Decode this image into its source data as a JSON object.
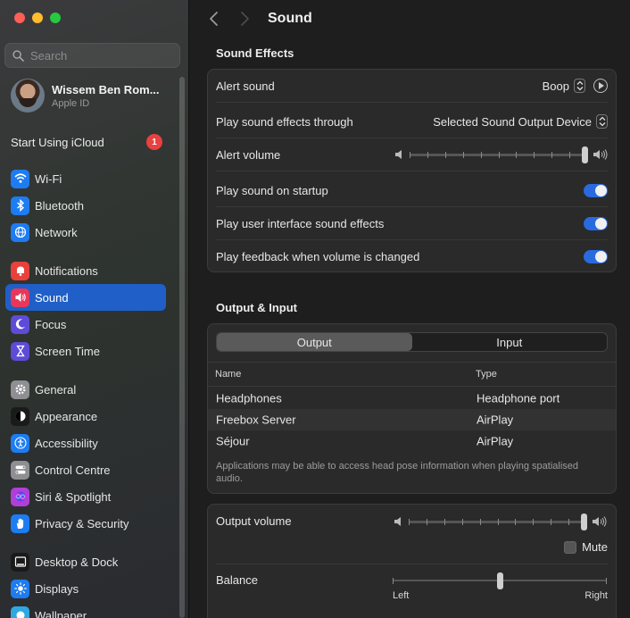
{
  "sidebar": {
    "search_placeholder": "Search",
    "profile": {
      "name": "Wissem Ben Rom...",
      "subtitle": "Apple ID"
    },
    "icloud": {
      "label": "Start Using iCloud",
      "badge": "1"
    },
    "items": [
      {
        "label": "Wi-Fi",
        "icon": "wifi-icon",
        "color": "#1d7cf2"
      },
      {
        "label": "Bluetooth",
        "icon": "bluetooth-icon",
        "color": "#1d7cf2"
      },
      {
        "label": "Network",
        "icon": "globe-icon",
        "color": "#1d7cf2"
      },
      {
        "label": "Notifications",
        "icon": "bell-icon",
        "color": "#e8413b"
      },
      {
        "label": "Sound",
        "icon": "speaker-icon",
        "color": "#e8375a"
      },
      {
        "label": "Focus",
        "icon": "moon-icon",
        "color": "#5e4bd8"
      },
      {
        "label": "Screen Time",
        "icon": "hourglass-icon",
        "color": "#5e4bd8"
      },
      {
        "label": "General",
        "icon": "gear-icon",
        "color": "#8e8e93"
      },
      {
        "label": "Appearance",
        "icon": "appearance-icon",
        "color": "#1a1a1a"
      },
      {
        "label": "Accessibility",
        "icon": "accessibility-icon",
        "color": "#1d7cf2"
      },
      {
        "label": "Control Centre",
        "icon": "control-centre-icon",
        "color": "#8e8e93"
      },
      {
        "label": "Siri & Spotlight",
        "icon": "siri-icon",
        "color": "#b03fd8"
      },
      {
        "label": "Privacy & Security",
        "icon": "hand-icon",
        "color": "#1d7cf2"
      },
      {
        "label": "Desktop & Dock",
        "icon": "dock-icon",
        "color": "#1a1a1a"
      },
      {
        "label": "Displays",
        "icon": "sun-icon",
        "color": "#1d7cf2"
      },
      {
        "label": "Wallpaper",
        "icon": "wallpaper-icon",
        "color": "#2fa8e0"
      }
    ],
    "active_item": "Sound"
  },
  "header": {
    "title": "Sound"
  },
  "sound_effects": {
    "title": "Sound Effects",
    "alert_sound": {
      "label": "Alert sound",
      "value": "Boop"
    },
    "play_through": {
      "label": "Play sound effects through",
      "value": "Selected Sound Output Device"
    },
    "alert_volume": {
      "label": "Alert volume",
      "level": 1.0
    },
    "startup": {
      "label": "Play sound on startup",
      "on": true
    },
    "ui_sounds": {
      "label": "Play user interface sound effects",
      "on": true
    },
    "feedback": {
      "label": "Play feedback when volume is changed",
      "on": true
    }
  },
  "output_input": {
    "title": "Output & Input",
    "tabs": [
      "Output",
      "Input"
    ],
    "selected_tab": "Output",
    "columns": [
      "Name",
      "Type"
    ],
    "devices": [
      {
        "name": "Headphones",
        "type": "Headphone port"
      },
      {
        "name": "Freebox Server",
        "type": "AirPlay"
      },
      {
        "name": "Séjour",
        "type": "AirPlay"
      }
    ],
    "note": "Applications may be able to access head pose information when playing spatialised audio."
  },
  "volume": {
    "output_label": "Output volume",
    "output_level": 1.0,
    "mute_label": "Mute",
    "muted": false,
    "balance_label": "Balance",
    "balance_value": 0.5,
    "left_label": "Left",
    "right_label": "Right"
  },
  "colors": {
    "accent": "#2a6ae0",
    "selection": "#1f5fc7"
  }
}
